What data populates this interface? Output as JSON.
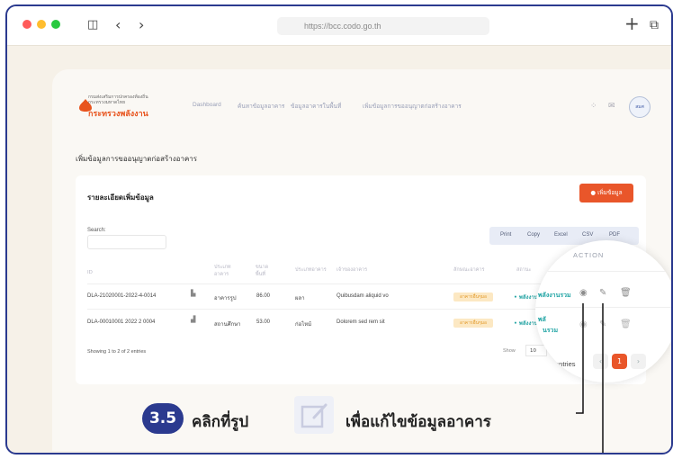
{
  "browser": {
    "url": "https://bcc.codo.go.th",
    "colors": {
      "close": "#ff5b5a",
      "minimize": "#ffbd2e",
      "maximize": "#28c940"
    },
    "icons": [
      "sidebar-icon",
      "back-icon",
      "forward-icon",
      "plus-icon",
      "copy-icon"
    ]
  },
  "app": {
    "logo": {
      "line1": "กรมส่งเสริมการปกครองท้องถิ่น",
      "line2": "กระทรวงมหาดไทย",
      "name": "กระทรวงพลังงาน"
    },
    "nav": [
      "Dashboard",
      "ค้นหาข้อมูลอาคาร",
      "ข้อมูลอาคารในพื้นที่",
      "เพิ่มข้อมูลการขออนุญาตก่อสร้างอาคาร"
    ],
    "seal_label": "สมศ",
    "page_title": "เพิ่มข้อมูลการขออนุญาตก่อสร้างอาคาร"
  },
  "card": {
    "title": "รายละเอียดเพิ่มข้อมูล",
    "add_button": "เพิ่มข้อมูล",
    "search_label": "Search:",
    "exports": [
      "Print",
      "Copy",
      "Excel",
      "CSV",
      "PDF"
    ],
    "columns": [
      "ID",
      "ประเภทอาคาร",
      "ขนาดพื้นที่",
      "ประเภทอาคาร",
      "เจ้าของอาคาร",
      "ลักษณะอาคาร",
      "สถานะ"
    ],
    "rows": [
      {
        "id": "DLA-21020001-2022-4-0014",
        "type": "อาคารรูป",
        "area": "86.00",
        "category": "ผลา",
        "owner": "Quibusdam aliquid vo",
        "badge": "อาคารอื่นๆมอ",
        "status": "• พลังงานรวม"
      },
      {
        "id": "DLA-00010001 2022 2 0004",
        "type": "สถานศึกษา",
        "area": "53.00",
        "category": "ก่อไหม้",
        "owner": "Dolorem sed rem sit",
        "badge": "อาคารอื่นๆมอ",
        "status": "• พลังงานรวม"
      }
    ],
    "footer": "Showing 1 to 2 of 2 entries",
    "show_label": "Show",
    "show_value": "10"
  },
  "magnifier": {
    "action_header": "ACTION",
    "row_status_1": "• พลังงานรวม",
    "row_status_2_a": "• พลั",
    "row_status_2_b": "นรวม",
    "entries_label": "entries",
    "page_current": "1"
  },
  "callout": {
    "step": "3.5",
    "text_before": "คลิกที่รูป",
    "text_after": "เพื่อแก้ไขข้อมูลอาคาร",
    "colors": {
      "badge": "#2b3a8f",
      "icon_bg": "#eef0f7"
    }
  }
}
